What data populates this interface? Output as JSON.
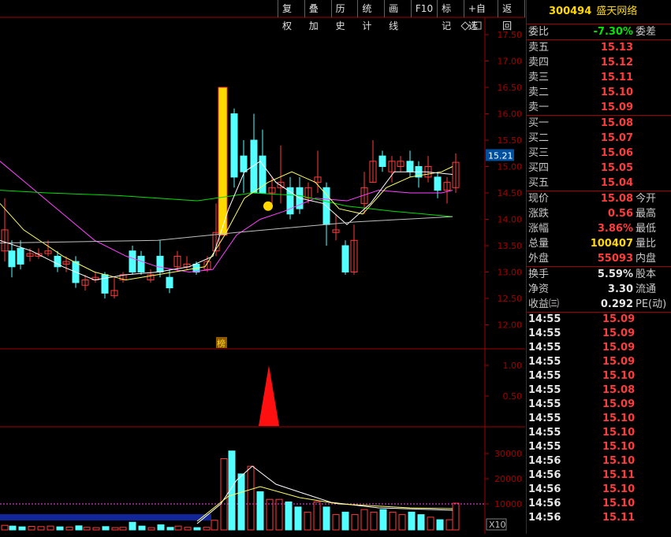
{
  "toolbar": [
    "复权",
    "叠加",
    "历史",
    "统计",
    "画线",
    "F10",
    "标记",
    "+自选",
    "返回"
  ],
  "stock": {
    "code": "300494",
    "name": "盛天网络"
  },
  "order_book": [
    {
      "label": "委比",
      "value": "-7.30%",
      "extra": "委差",
      "color": "#00e600"
    },
    {
      "label": "卖五",
      "value": "15.13",
      "color": "#ff3b3b"
    },
    {
      "label": "卖四",
      "value": "15.12",
      "color": "#ff3b3b"
    },
    {
      "label": "卖三",
      "value": "15.11",
      "color": "#ff3b3b"
    },
    {
      "label": "卖二",
      "value": "15.10",
      "color": "#ff3b3b"
    },
    {
      "label": "卖一",
      "value": "15.09",
      "color": "#ff3b3b"
    },
    {
      "label": "买一",
      "value": "15.08",
      "color": "#ff3b3b"
    },
    {
      "label": "买二",
      "value": "15.07",
      "color": "#ff3b3b"
    },
    {
      "label": "买三",
      "value": "15.06",
      "color": "#ff3b3b"
    },
    {
      "label": "买四",
      "value": "15.05",
      "color": "#ff3b3b"
    },
    {
      "label": "买五",
      "value": "15.04",
      "color": "#ff3b3b"
    }
  ],
  "quote": [
    {
      "label": "现价",
      "value": "15.08",
      "extra": "今开",
      "color": "#ff3b3b"
    },
    {
      "label": "涨跌",
      "value": "0.56",
      "extra": "最高",
      "color": "#ff3b3b"
    },
    {
      "label": "涨幅",
      "value": "3.86%",
      "extra": "最低",
      "color": "#ff3b3b"
    },
    {
      "label": "总量",
      "value": "100407",
      "extra": "量比",
      "color": "#ffd800"
    },
    {
      "label": "外盘",
      "value": "55093",
      "extra": "内盘",
      "color": "#ff3b3b"
    }
  ],
  "fundamentals": [
    {
      "label": "换手",
      "value": "5.59%",
      "extra": "股本",
      "color": "#e6e6e6"
    },
    {
      "label": "净资",
      "value": "3.30",
      "extra": "流通",
      "color": "#e6e6e6"
    },
    {
      "label": "收益㈢",
      "value": "0.292",
      "extra": "PE(动)",
      "color": "#e6e6e6"
    }
  ],
  "trades": [
    {
      "time": "14:55",
      "price": "15.09"
    },
    {
      "time": "14:55",
      "price": "15.09"
    },
    {
      "time": "14:55",
      "price": "15.09"
    },
    {
      "time": "14:55",
      "price": "15.09"
    },
    {
      "time": "14:55",
      "price": "15.10"
    },
    {
      "time": "14:55",
      "price": "15.08"
    },
    {
      "time": "14:55",
      "price": "15.09"
    },
    {
      "time": "14:55",
      "price": "15.10"
    },
    {
      "time": "14:55",
      "price": "15.10"
    },
    {
      "time": "14:55",
      "price": "15.10"
    },
    {
      "time": "14:56",
      "price": "15.10"
    },
    {
      "time": "14:56",
      "price": "15.11"
    },
    {
      "time": "14:56",
      "price": "15.10"
    },
    {
      "time": "14:56",
      "price": "15.10"
    },
    {
      "time": "14:56",
      "price": "15.11"
    }
  ],
  "chart": {
    "price_axis": [
      "17.50",
      "17.00",
      "16.50",
      "16.00",
      "15.50",
      "15.00",
      "14.50",
      "14.00",
      "13.50",
      "13.00",
      "12.50",
      "12.00"
    ],
    "current_price_tag": "15.21",
    "indicator_axis": [
      "1.00",
      "0.50"
    ],
    "volume_axis": [
      "30000",
      "20000",
      "10000"
    ],
    "volume_unit": "X10",
    "marker_label": "榜",
    "colors": {
      "up": "#ff3b3b",
      "down": "#54ffff",
      "ma5": "#ffffff",
      "ma10": "#ffff66",
      "ma20": "#ff40ff",
      "ma60": "#00dd00",
      "frame": "#a00000",
      "special": "#ffd800"
    }
  }
}
